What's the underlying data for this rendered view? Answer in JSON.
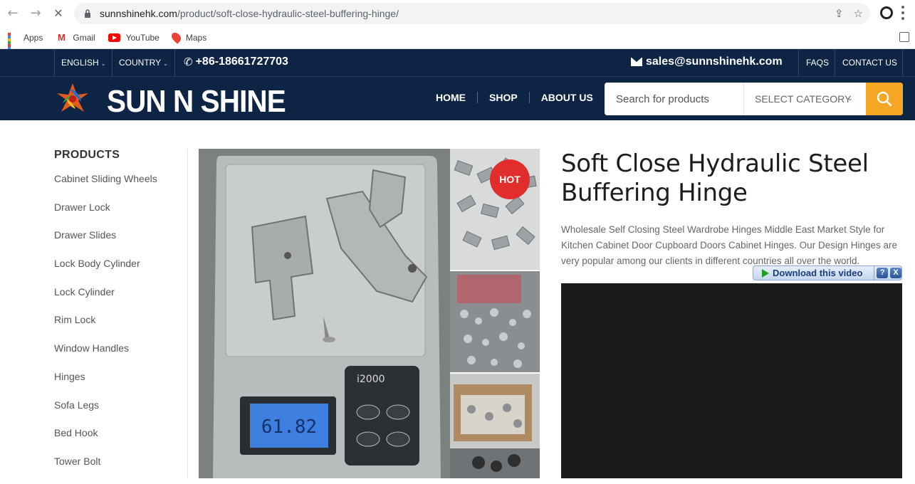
{
  "browser": {
    "url_domain": "sunnshinehk.com",
    "url_path": "/product/soft-close-hydraulic-steel-buffering-hinge/",
    "back_icon": "arrow-left-icon",
    "forward_icon": "arrow-right-icon",
    "reload_icon": "close-loading-icon",
    "bookmarks": [
      {
        "label": "Apps",
        "icon": "apps-grid-icon"
      },
      {
        "label": "Gmail",
        "icon": "gmail-icon"
      },
      {
        "label": "YouTube",
        "icon": "youtube-icon"
      },
      {
        "label": "Maps",
        "icon": "maps-icon"
      }
    ]
  },
  "topbar": {
    "language": "ENGLISH",
    "country": "COUNTRY",
    "phone": "+86-18661727703",
    "email": "sales@sunnshinehk.com",
    "faqs": "FAQS",
    "contact": "CONTACT US"
  },
  "header": {
    "logo_text": "SUN N SHINE",
    "nav": [
      "HOME",
      "SHOP",
      "ABOUT US"
    ],
    "search_placeholder": "Search for products",
    "category_label": "SELECT CATEGORY",
    "colors": {
      "navy": "#0e2445",
      "accent": "#f5a623"
    }
  },
  "sidebar": {
    "title": "PRODUCTS",
    "items": [
      "Cabinet Sliding Wheels",
      "Drawer Lock",
      "Drawer Slides",
      "Lock Body Cylinder",
      "Lock Cylinder",
      "Rim Lock",
      "Window Handles",
      "Hinges",
      "Sofa Legs",
      "Bed Hook",
      "Tower Bolt"
    ]
  },
  "product": {
    "badge": "HOT",
    "title": "Soft Close Hydraulic Steel Buffering Hinge",
    "description": "Wholesale Self Closing Steel Wardrobe Hinges Middle East Market Style for Kitchen Cabinet Door Cupboard Doors Cabinet Hinges. Our Design Hinges are very popular among our clients in different countries all over the world.",
    "scale_display": "61.82",
    "scale_brand": "i2000"
  },
  "download_bar": {
    "label": "Download this video",
    "help": "?",
    "close": "X"
  }
}
